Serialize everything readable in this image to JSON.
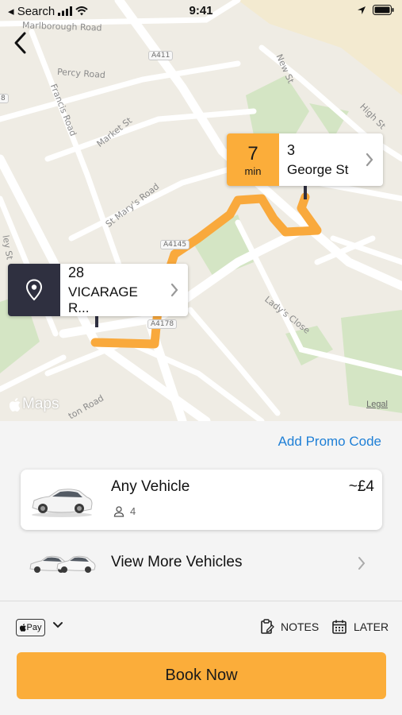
{
  "status_bar": {
    "back_app_label": "◂ Search",
    "time": "9:41"
  },
  "map": {
    "road_labels": [
      "Marlborough Road",
      "Percy Road",
      "Francis Road",
      "Market St",
      "St Mary's Road",
      "New St",
      "High St",
      "Lady's Close",
      "ley St",
      "ton Road"
    ],
    "road_shields": [
      "A411",
      "A4145",
      "A4178",
      "8"
    ],
    "destination": {
      "eta_value": "7",
      "eta_unit": "min",
      "house_number": "3",
      "street": "George St"
    },
    "pickup": {
      "house_number": "28",
      "street": "VICARAGE R..."
    },
    "attribution": "Maps",
    "legal": "Legal"
  },
  "panel": {
    "promo_label": "Add Promo Code",
    "vehicle": {
      "name": "Any Vehicle",
      "price": "~£4",
      "seats": "4"
    },
    "more_vehicles_label": "View More Vehicles",
    "payment_label": "Pay",
    "notes_label": "NOTES",
    "later_label": "LATER",
    "book_label": "Book Now"
  },
  "colors": {
    "accent": "#fbad3a",
    "route": "#f9a93c",
    "pickup_tag": "#2f3040",
    "link": "#1e7fd6"
  }
}
